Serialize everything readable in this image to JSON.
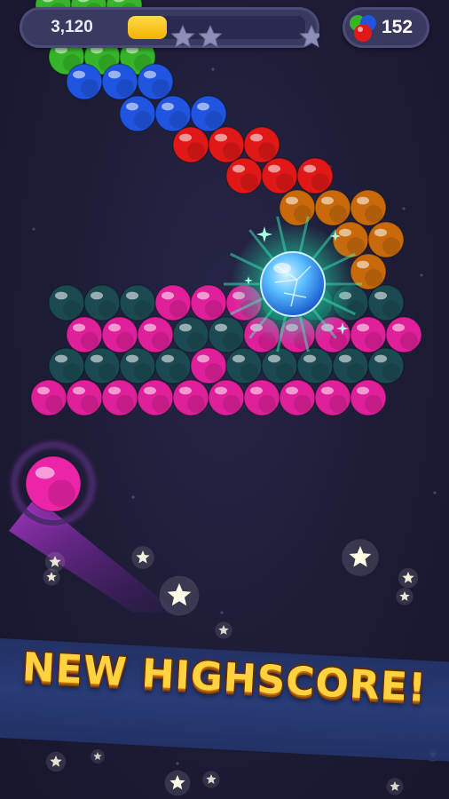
{
  "hud": {
    "score": "3,120",
    "progress": 0.22,
    "progress_color": "#f5c21a",
    "star_icons": [
      "star-icon",
      "star-icon",
      "star-icon"
    ],
    "bubble_count": "152"
  },
  "banner": {
    "text": "NEW HIGHSCORE!"
  },
  "board": {
    "colors": {
      "green": "#36b52a",
      "blue": "#1f55e0",
      "red": "#e01818",
      "orange": "#c86a0c",
      "magenta": "#e0209a",
      "teal": "#1c4a52",
      "shooter": "#ec24a8"
    },
    "shooter_color": "magenta",
    "special_bubble": "crystal-ice-bubble"
  }
}
